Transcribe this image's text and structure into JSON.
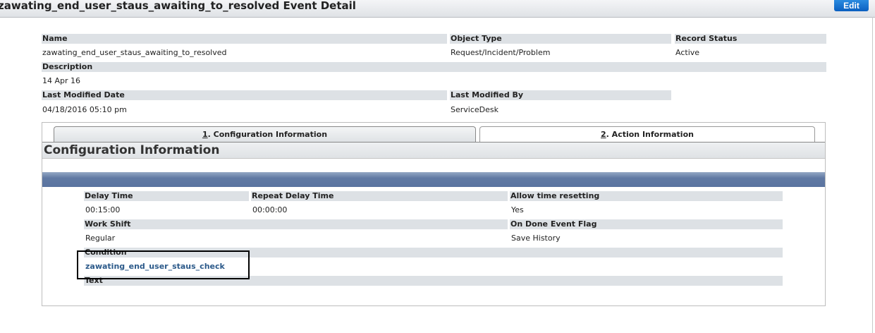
{
  "header": {
    "title": "zawating_end_user_staus_awaiting_to_resolved Event Detail",
    "edit_label": "Edit"
  },
  "details": {
    "name": {
      "label": "Name",
      "value": "zawating_end_user_staus_awaiting_to_resolved"
    },
    "object_type": {
      "label": "Object Type",
      "value": "Request/Incident/Problem"
    },
    "record_status": {
      "label": "Record Status",
      "value": "Active"
    },
    "description": {
      "label": "Description",
      "value": "14 Apr 16"
    },
    "last_modified_date": {
      "label": "Last Modified Date",
      "value": "04/18/2016 05:10 pm"
    },
    "last_modified_by": {
      "label": "Last Modified By",
      "value": "ServiceDesk"
    }
  },
  "tabs": [
    {
      "num": "1",
      "label": ". Configuration Information"
    },
    {
      "num": "2",
      "label": ". Action Information"
    }
  ],
  "section": {
    "title": "Configuration Information"
  },
  "config": {
    "delay_time": {
      "label": "Delay Time",
      "value": "00:15:00"
    },
    "repeat_delay_time": {
      "label": "Repeat Delay Time",
      "value": "00:00:00"
    },
    "allow_time_resetting": {
      "label": "Allow time resetting",
      "value": "Yes"
    },
    "work_shift": {
      "label": "Work Shift",
      "value": "Regular"
    },
    "on_done_event_flag": {
      "label": "On Done Event Flag",
      "value": "Save History"
    },
    "condition": {
      "label": "Condition",
      "value": "zawating_end_user_staus_check"
    },
    "text": {
      "label": "Text"
    }
  }
}
